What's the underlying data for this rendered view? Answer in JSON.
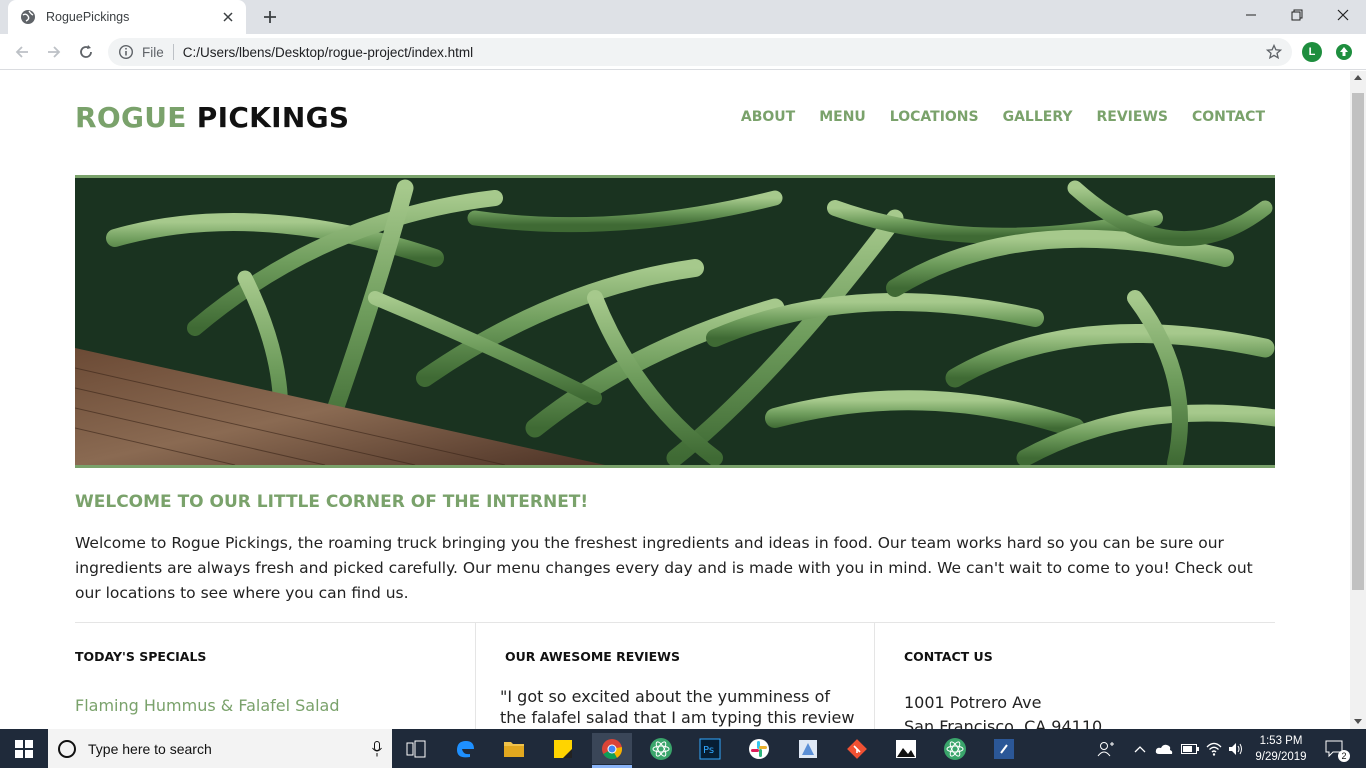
{
  "browser": {
    "tab_title": "RoguePickings",
    "file_label": "File",
    "url": "C:/Users/lbens/Desktop/rogue-project/index.html",
    "profile_initial": "L",
    "colors": {
      "tabbar": "#dee1e6",
      "omnibox": "#f1f3f4",
      "profile": "#1e8e3e"
    }
  },
  "site": {
    "logo_part1": "ROGUE",
    "logo_part2": "PICKINGS",
    "accent_color": "#7aa26b",
    "nav": [
      "ABOUT",
      "MENU",
      "LOCATIONS",
      "GALLERY",
      "REVIEWS",
      "CONTACT"
    ],
    "hero_image": "green-beans-photo",
    "welcome_title": "WELCOME TO OUR LITTLE CORNER OF THE INTERNET!",
    "welcome_text": "Welcome to Rogue Pickings, the roaming truck bringing you the freshest ingredients and ideas in food. Our team works hard so you can be sure our ingredients are always fresh and picked carefully. Our menu changes every day and is made with you in mind. We can't wait to come to you! Check out our locations to see where you can find us.",
    "specials": {
      "title": "TODAY'S SPECIALS",
      "items": [
        "Flaming Hummus & Falafel Salad"
      ]
    },
    "reviews": {
      "title": "OUR AWESOME REVIEWS",
      "text": "\"I got so excited about the yumminess of the falafel salad that I am typing this review"
    },
    "contact": {
      "title": "CONTACT US",
      "address_line1": "1001 Potrero Ave",
      "address_line2": "San Francisco, CA 94110"
    }
  },
  "taskbar": {
    "search_placeholder": "Type here to search",
    "time": "1:53 PM",
    "date": "9/29/2019",
    "notification_count": "2",
    "apps": [
      "task-view-icon",
      "edge-icon",
      "file-explorer-icon",
      "sticky-notes-icon",
      "chrome-icon",
      "atom-icon",
      "photoshop-icon",
      "slack-icon",
      "paint-icon",
      "git-icon",
      "photos-icon",
      "atom-icon-2",
      "notepad-icon"
    ]
  }
}
